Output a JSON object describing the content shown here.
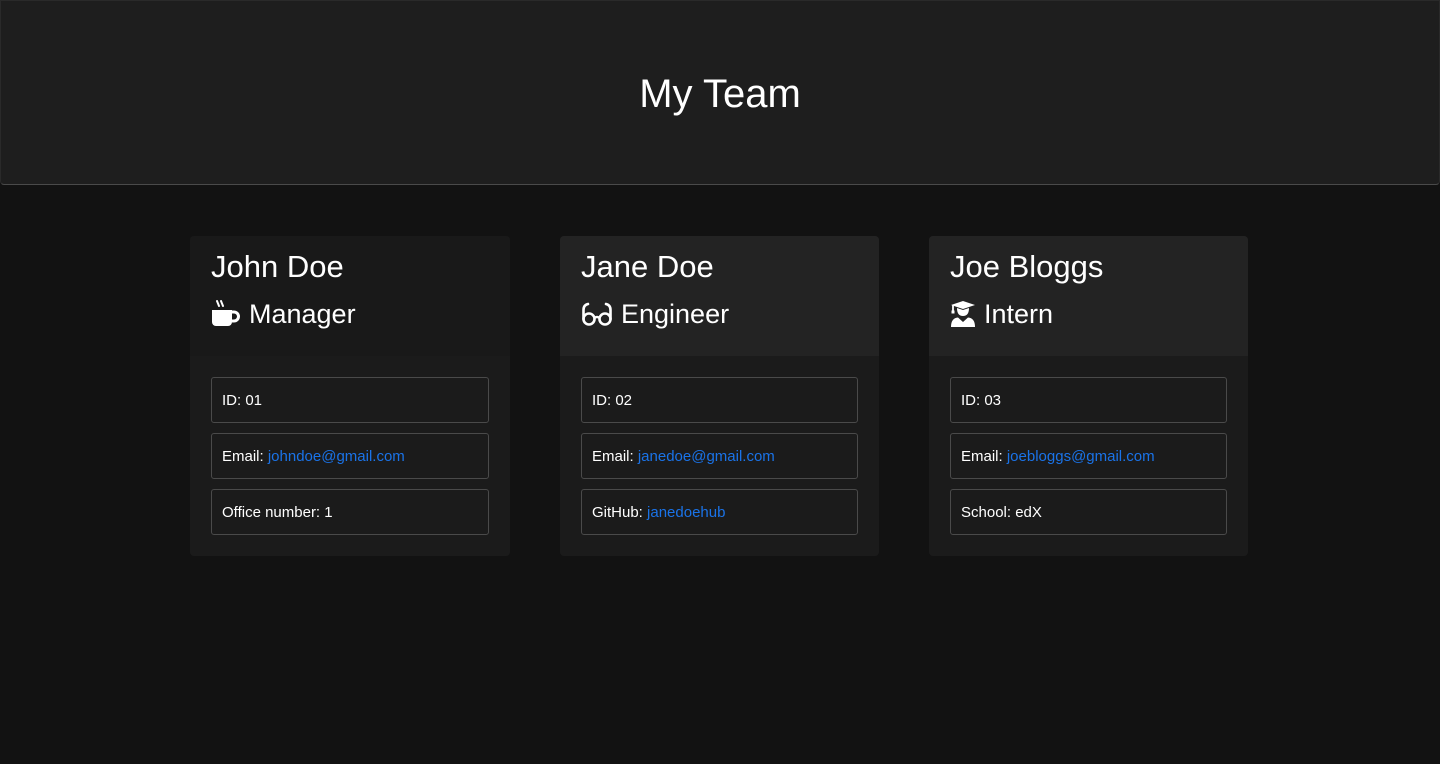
{
  "header": {
    "title": "My Team"
  },
  "colors": {
    "background": "#121212",
    "header_bg": "#1e1e1e",
    "card_bg": "#1b1b1b",
    "link": "#1a73e8",
    "text": "#ffffff"
  },
  "team": [
    {
      "name": "John Doe",
      "role": "Manager",
      "role_icon": "mug-hot-icon",
      "id_label": "ID: ",
      "id": "01",
      "email_label": "Email: ",
      "email": "johndoe@gmail.com",
      "extra_label": "Office number: ",
      "extra_value": "1"
    },
    {
      "name": "Jane Doe",
      "role": "Engineer",
      "role_icon": "glasses-icon",
      "id_label": "ID: ",
      "id": "02",
      "email_label": "Email: ",
      "email": "janedoe@gmail.com",
      "extra_label": "GitHub: ",
      "extra_value": "janedoehub"
    },
    {
      "name": "Joe Bloggs",
      "role": "Intern",
      "role_icon": "user-graduate-icon",
      "id_label": "ID: ",
      "id": "03",
      "email_label": "Email: ",
      "email": "joebloggs@gmail.com",
      "extra_label": "School: ",
      "extra_value": "edX"
    }
  ]
}
